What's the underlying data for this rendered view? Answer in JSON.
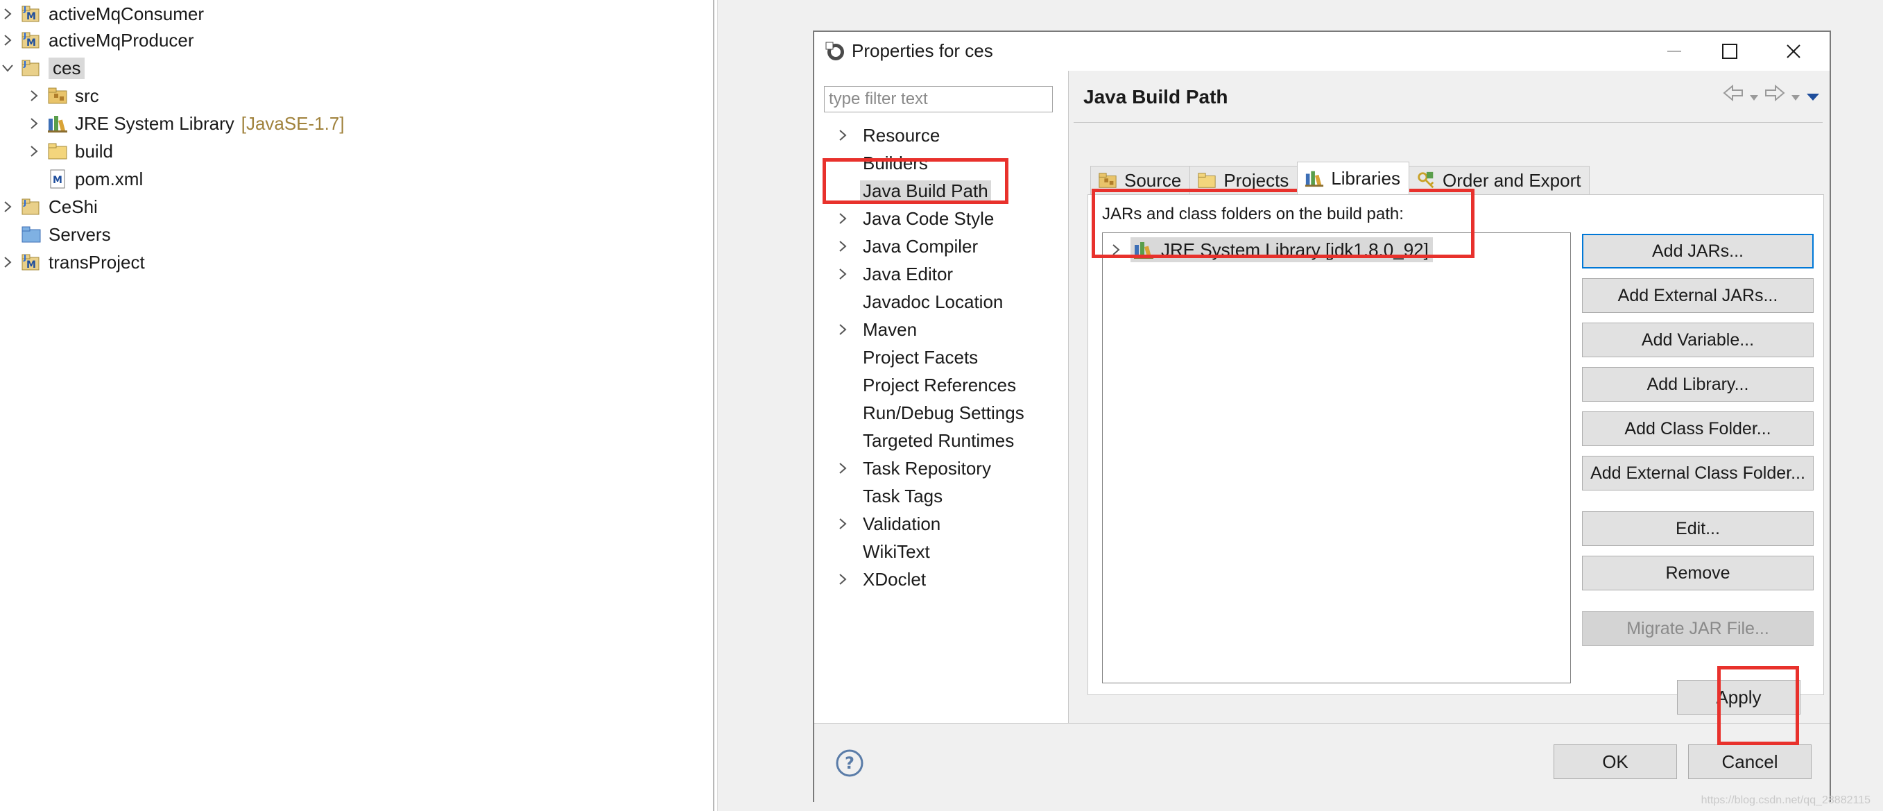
{
  "explorer": {
    "items": [
      {
        "label": "activeMqConsumer",
        "decoration": ""
      },
      {
        "label": "activeMqProducer",
        "decoration": ""
      },
      {
        "label": "ces",
        "decoration": ""
      },
      {
        "label": "src",
        "decoration": ""
      },
      {
        "label": "JRE System Library",
        "decoration": "[JavaSE-1.7]"
      },
      {
        "label": "build",
        "decoration": ""
      },
      {
        "label": "pom.xml",
        "decoration": ""
      },
      {
        "label": "CeShi",
        "decoration": ""
      },
      {
        "label": "Servers",
        "decoration": ""
      },
      {
        "label": "transProject",
        "decoration": ""
      }
    ]
  },
  "dialog": {
    "title": "Properties for ces",
    "filter_placeholder": "type filter text",
    "nav_items": [
      "Resource",
      "Builders",
      "Java Build Path",
      "Java Code Style",
      "Java Compiler",
      "Java Editor",
      "Javadoc Location",
      "Maven",
      "Project Facets",
      "Project References",
      "Run/Debug Settings",
      "Targeted Runtimes",
      "Task Repository",
      "Task Tags",
      "Validation",
      "WikiText",
      "XDoclet"
    ],
    "selected_nav": "Java Build Path",
    "page_title": "Java Build Path",
    "tabs": [
      "Source",
      "Projects",
      "Libraries",
      "Order and Export"
    ],
    "active_tab": "Libraries",
    "panel_label": "JARs and class folders on the build path:",
    "library_entry": "JRE System Library [jdk1.8.0_92]",
    "side_buttons": [
      "Add JARs...",
      "Add External JARs...",
      "Add Variable...",
      "Add Library...",
      "Add Class Folder...",
      "Add External Class Folder...",
      "Edit...",
      "Remove",
      "Migrate JAR File..."
    ],
    "apply_label": "Apply",
    "ok_label": "OK",
    "cancel_label": "Cancel",
    "help_symbol": "?"
  },
  "watermark": "https://blog.csdn.net/qq_28882115"
}
